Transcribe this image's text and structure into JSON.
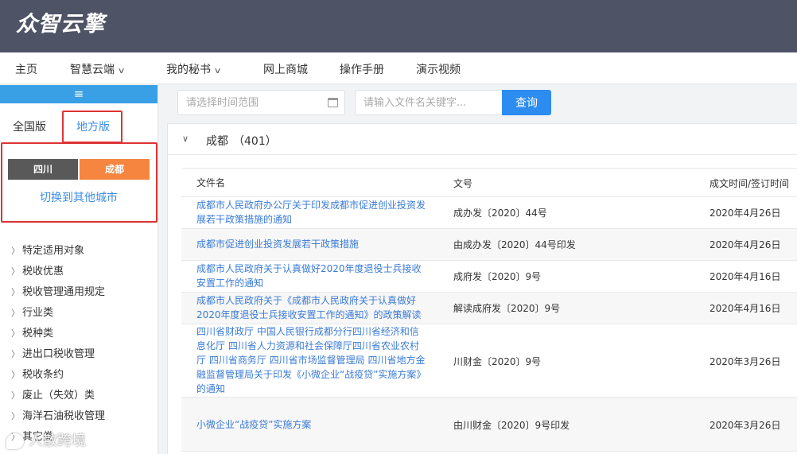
{
  "header": {
    "logo": "众智云擎"
  },
  "nav": {
    "items": [
      {
        "label": "主页",
        "caret": false
      },
      {
        "label": "智慧云端",
        "caret": true
      },
      {
        "label": "我的秘书",
        "caret": true
      },
      {
        "label": "网上商城",
        "caret": false
      },
      {
        "label": "操作手册",
        "caret": false
      },
      {
        "label": "演示视频",
        "caret": false
      }
    ]
  },
  "sidebar": {
    "toggle_icon": "hamburger-icon",
    "tabs": {
      "national": "全国版",
      "local": "地方版"
    },
    "province": "四川",
    "city": "成都",
    "switch_city": "切换到其他城市",
    "items": [
      "特定适用对象",
      "税收优惠",
      "税收管理通用规定",
      "行业类",
      "税种类",
      "进出口税收管理",
      "税收条约",
      "废止（失效）类",
      "海洋石油税收管理",
      "其它类"
    ]
  },
  "search": {
    "date_placeholder": "请选择时间范围",
    "keyword_placeholder": "请输入文件名关键字...",
    "button": "查询"
  },
  "group": {
    "title": "成都",
    "count": "（401）"
  },
  "table": {
    "headers": {
      "name": "文件名",
      "number": "文号",
      "date": "成文时间/签订时间"
    },
    "rows": [
      {
        "name": "成都市人民政府办公厅关于印发成都市促进创业投资发展若干政策措施的通知",
        "number": "成办发〔2020〕44号",
        "date": "2020年4月26日"
      },
      {
        "name": "成都市促进创业投资发展若干政策措施",
        "number": "由成办发〔2020〕44号印发",
        "date": "2020年4月26日"
      },
      {
        "name": "成都市人民政府关于认真做好2020年度退役士兵接收安置工作的通知",
        "number": "成府发〔2020〕9号",
        "date": "2020年4月16日"
      },
      {
        "name": "成都市人民政府关于《成都市人民政府关于认真做好2020年度退役士兵接收安置工作的通知》的政策解读",
        "number": "解读成府发〔2020〕9号",
        "date": "2020年4月16日"
      },
      {
        "name": "四川省财政厅 中国人民银行成都分行四川省经济和信息化厅 四川省人力资源和社会保障厅四川省农业农村厅 四川省商务厅 四川省市场监督管理局 四川省地方金融监督管理局关于印发《小微企业“战疫贷”实施方案》的通知",
        "number": "川财金〔2020〕9号",
        "date": "2020年3月26日"
      },
      {
        "name": "小微企业“战疫贷”实施方案",
        "number": "由川财金〔2020〕9号印发",
        "date": "2020年3月26日"
      }
    ]
  },
  "watermark": "人散跨境"
}
